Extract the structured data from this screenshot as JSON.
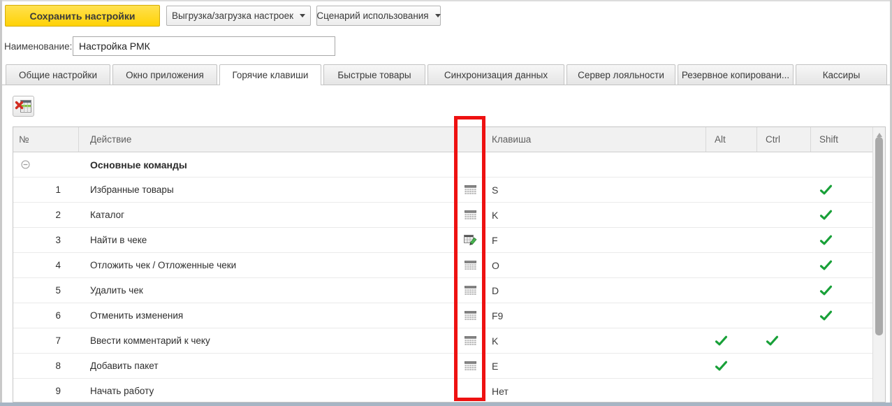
{
  "toolbar": {
    "save_button": "Сохранить настройки",
    "settings_dropdown": "Выгрузка/загрузка настроек",
    "scenario_dropdown": "Сценарий использования"
  },
  "name_field": {
    "label": "Наименование:",
    "value": "Настройка РМК"
  },
  "tabs": [
    {
      "label": "Общие настройки",
      "active": false
    },
    {
      "label": "Окно приложения",
      "active": false
    },
    {
      "label": "Горячие клавиши",
      "active": true
    },
    {
      "label": "Быстрые товары",
      "active": false
    },
    {
      "label": "Синхронизация данных",
      "active": false
    },
    {
      "label": "Сервер лояльности",
      "active": false
    },
    {
      "label": "Резервное копировани...",
      "active": false
    },
    {
      "label": "Кассиры",
      "active": false
    }
  ],
  "list_toolbar": {
    "excel_button_icon": "excel-table-icon"
  },
  "table": {
    "columns": {
      "num": "№",
      "action": "Действие",
      "icon": "",
      "key": "Клавиша",
      "alt": "Alt",
      "ctrl": "Ctrl",
      "shift": "Shift"
    },
    "group_row": {
      "label": "Основные команды",
      "collapsed": false
    },
    "rows": [
      {
        "num": "1",
        "action": "Избранные товары",
        "icon": "keyboard-icon",
        "key": "S",
        "alt": false,
        "ctrl": false,
        "shift": true
      },
      {
        "num": "2",
        "action": "Каталог",
        "icon": "keyboard-icon",
        "key": "K",
        "alt": false,
        "ctrl": false,
        "shift": true
      },
      {
        "num": "3",
        "action": "Найти в чеке",
        "icon": "table-edit-icon",
        "key": "F",
        "alt": false,
        "ctrl": false,
        "shift": true
      },
      {
        "num": "4",
        "action": "Отложить чек / Отложенные чеки",
        "icon": "keyboard-icon",
        "key": "O",
        "alt": false,
        "ctrl": false,
        "shift": true
      },
      {
        "num": "5",
        "action": "Удалить чек",
        "icon": "keyboard-icon",
        "key": "D",
        "alt": false,
        "ctrl": false,
        "shift": true
      },
      {
        "num": "6",
        "action": "Отменить изменения",
        "icon": "keyboard-icon",
        "key": "F9",
        "alt": false,
        "ctrl": false,
        "shift": true
      },
      {
        "num": "7",
        "action": "Ввести комментарий к чеку",
        "icon": "keyboard-icon",
        "key": "K",
        "alt": true,
        "ctrl": true,
        "shift": false
      },
      {
        "num": "8",
        "action": "Добавить пакет",
        "icon": "keyboard-icon",
        "key": "E",
        "alt": true,
        "ctrl": false,
        "shift": false
      },
      {
        "num": "9",
        "action": "Начать работу",
        "icon": null,
        "key": "Нет",
        "alt": false,
        "ctrl": false,
        "shift": false
      }
    ]
  },
  "annotation": {
    "shape": "red-rectangle",
    "target": "icon-column",
    "color": "#ee1111"
  },
  "colors": {
    "save_button_bg": "#ffd60b",
    "check_green": "#18a038",
    "annotation_red": "#ee1111"
  }
}
